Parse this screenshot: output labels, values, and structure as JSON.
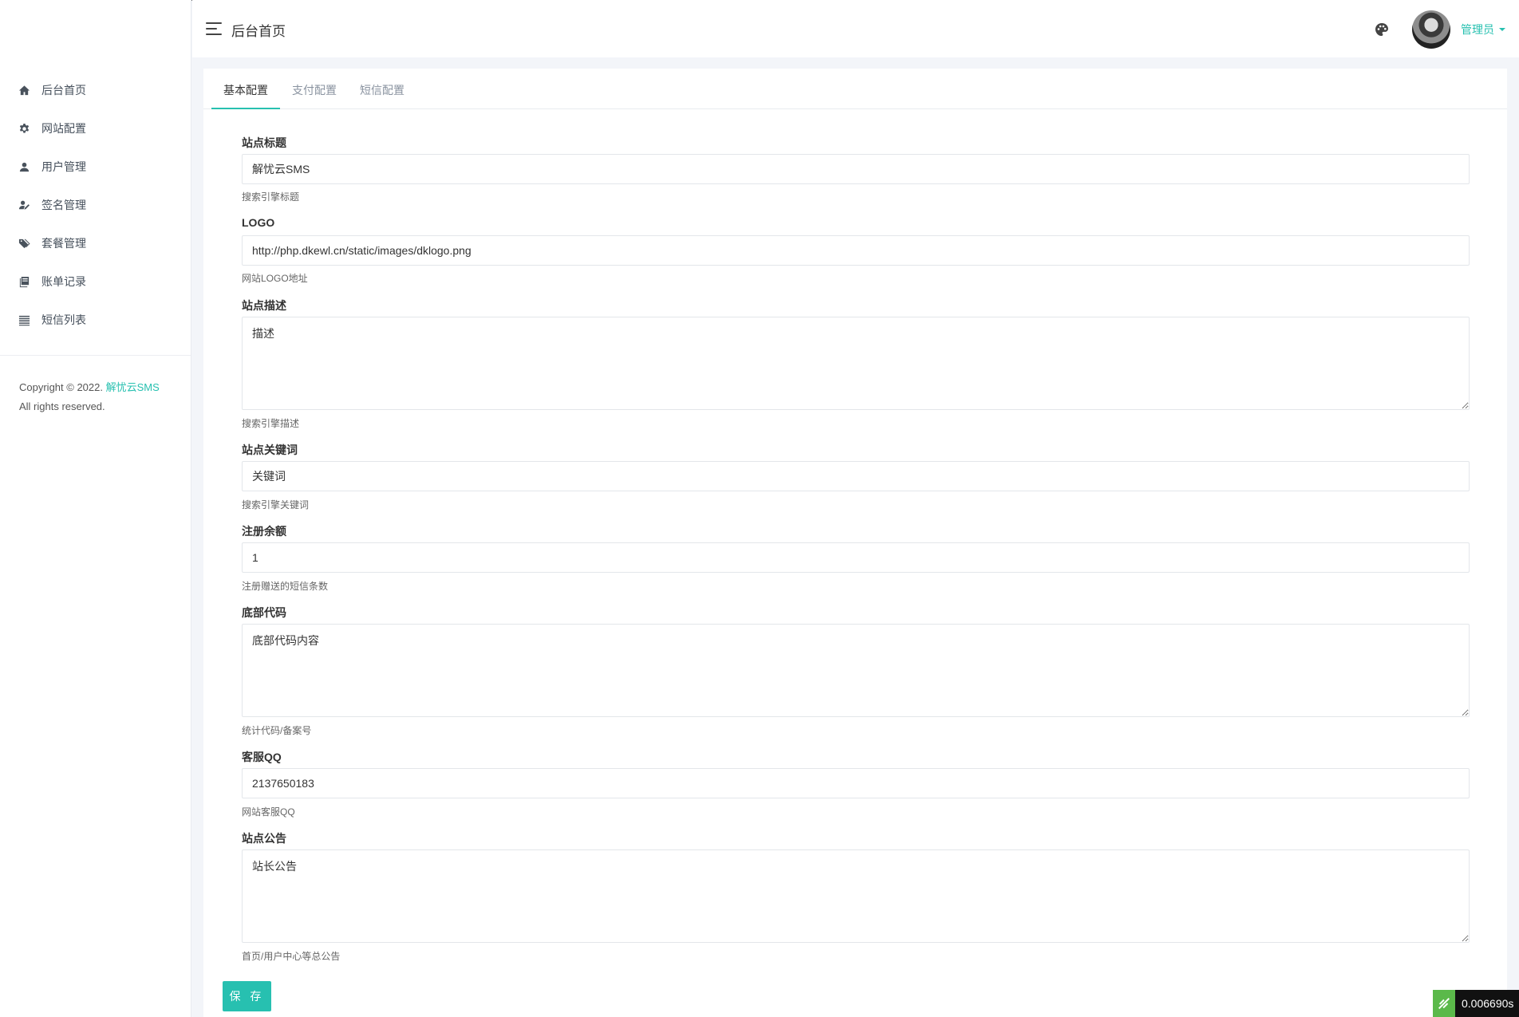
{
  "header": {
    "title": "后台首页",
    "user_label": "管理员"
  },
  "sidebar": {
    "items": [
      {
        "label": "后台首页",
        "icon": "home-icon"
      },
      {
        "label": "网站配置",
        "icon": "gear-icon"
      },
      {
        "label": "用户管理",
        "icon": "user-icon"
      },
      {
        "label": "签名管理",
        "icon": "signature-icon"
      },
      {
        "label": "套餐管理",
        "icon": "tags-icon"
      },
      {
        "label": "账单记录",
        "icon": "book-icon"
      },
      {
        "label": "短信列表",
        "icon": "list-icon"
      }
    ],
    "copyright_prefix": "Copyright © 2022.",
    "copyright_link": "解忧云SMS",
    "copyright_suffix": "All rights reserved."
  },
  "tabs": [
    {
      "label": "基本配置",
      "active": true
    },
    {
      "label": "支付配置",
      "active": false
    },
    {
      "label": "短信配置",
      "active": false
    }
  ],
  "form": {
    "site_title": {
      "label": "站点标题",
      "value": "解忧云SMS",
      "help": "搜索引擎标题"
    },
    "logo": {
      "label": "LOGO",
      "value": "http://php.dkewl.cn/static/images/dklogo.png",
      "help": "网站LOGO地址"
    },
    "description": {
      "label": "站点描述",
      "value": "描述",
      "help": "搜索引擎描述"
    },
    "keywords": {
      "label": "站点关键词",
      "value": "关键词",
      "help": "搜索引擎关键词"
    },
    "register_balance": {
      "label": "注册余额",
      "value": "1",
      "help": "注册赠送的短信条数"
    },
    "footer_code": {
      "label": "底部代码",
      "value": "底部代码内容",
      "help": "统计代码/备案号"
    },
    "service_qq": {
      "label": "客服QQ",
      "value": "2137650183",
      "help": "网站客服QQ"
    },
    "notice": {
      "label": "站点公告",
      "value": "站长公告",
      "help": "首页/用户中心等总公告"
    },
    "save_label": "保 存"
  },
  "debug": {
    "time": "0.006690s"
  },
  "colors": {
    "accent": "#27c0b0"
  }
}
